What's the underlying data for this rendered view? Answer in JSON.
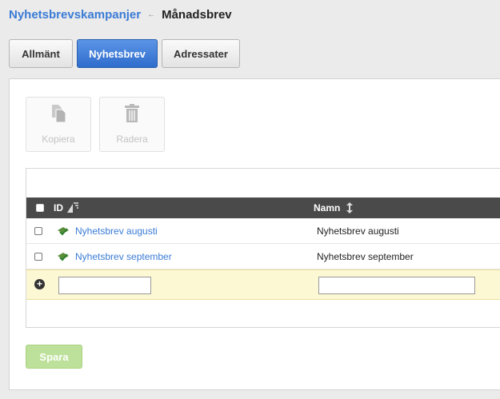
{
  "breadcrumb": {
    "parent": "Nyhetsbrevskampanjer",
    "separator": "←",
    "current": "Månadsbrev"
  },
  "tabs": [
    {
      "label": "Allmänt",
      "active": false
    },
    {
      "label": "Nyhetsbrev",
      "active": true
    },
    {
      "label": "Adressater",
      "active": false
    }
  ],
  "toolbar": {
    "copy_label": "Kopiera",
    "delete_label": "Radera"
  },
  "grid": {
    "columns": {
      "id": "ID",
      "name": "Namn"
    },
    "rows": [
      {
        "id_link": "Nyhetsbrev augusti",
        "name": "Nyhetsbrev augusti"
      },
      {
        "id_link": "Nyhetsbrev september",
        "name": "Nyhetsbrev september"
      }
    ],
    "new_row": {
      "id_value": "",
      "name_value": ""
    }
  },
  "actions": {
    "save_label": "Spara"
  },
  "colors": {
    "accent": "#3a7bd5",
    "active_tab": "#2f6dcc",
    "header_bg": "#4a4a4a",
    "new_row_bg": "#fdf8d4",
    "save_bg": "#bde19a"
  }
}
